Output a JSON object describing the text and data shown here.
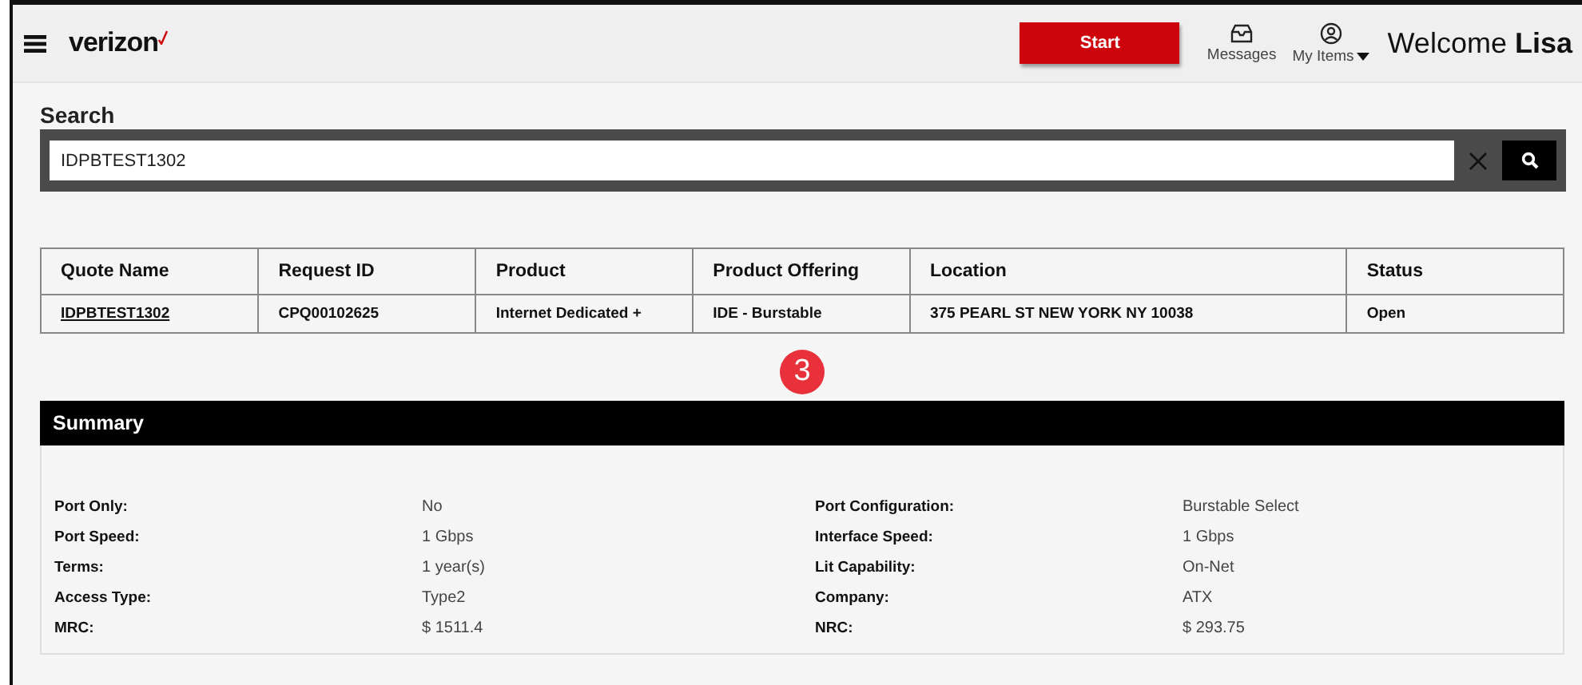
{
  "header": {
    "logo": "verizon",
    "start_button": "Start",
    "messages": "Messages",
    "my_items": "My Items",
    "welcome": "Welcome **Lisa**"
  },
  "search": {
    "label": "Search",
    "value": "IDPBTEST1302"
  },
  "table": {
    "columns": [
      "Quote Name",
      "Request ID",
      "Product",
      "Product Offering",
      "Location",
      "Status"
    ],
    "rows": [
      [
        "IDPBTEST1302",
        "CPQ00102625",
        "Internet Dedicated +",
        "IDE - Burstable",
        "375 PEARL ST NEW YORK NY 10038",
        "Open"
      ]
    ]
  },
  "step_badge": "3",
  "summary": {
    "title": "Summary",
    "fields": [
      {
        "label": "Port Only:",
        "value": "No"
      },
      {
        "label": "Port Configuration:",
        "value": "Burstable Select"
      },
      {
        "label": "Port Speed:",
        "value": "1 Gbps"
      },
      {
        "label": "Interface Speed:",
        "value": "1 Gbps"
      },
      {
        "label": "Terms:",
        "value": "1 year(s)"
      },
      {
        "label": "Lit Capability:",
        "value": "On-Net"
      },
      {
        "label": "Access Type:",
        "value": "Type2"
      },
      {
        "label": "Company:",
        "value": "ATX"
      },
      {
        "label": "MRC:",
        "value": "$ 1511.4"
      },
      {
        "label": "NRC:",
        "value": "$ 293.75"
      }
    ]
  }
}
